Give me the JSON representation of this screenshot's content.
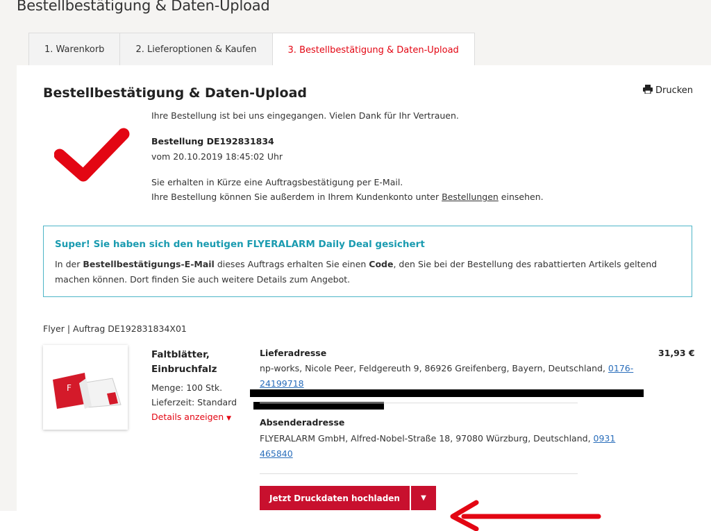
{
  "header": {
    "title": "Bestellbestätigung & Daten-Upload"
  },
  "tabs": [
    {
      "label": "1. Warenkorb"
    },
    {
      "label": "2. Lieferoptionen & Kaufen"
    },
    {
      "label": "3. Bestellbestätigung & Daten-Upload"
    }
  ],
  "confirmation": {
    "title": "Bestellbestätigung & Daten-Upload",
    "print_label": "Drucken",
    "thanks": "Ihre Bestellung ist bei uns eingegangen. Vielen Dank für Ihr Vertrauen.",
    "order_label": "Bestellung DE192831834",
    "order_date": "vom 20.10.2019 18:45:02 Uhr",
    "email_note": "Sie erhalten in Kürze eine Auftragsbestätigung per E-Mail.",
    "account_note_prefix": "Ihre Bestellung können Sie außerdem in Ihrem Kundenkonto unter",
    "account_link": "Bestellungen",
    "account_note_suffix": "einsehen."
  },
  "deal": {
    "title": "Super! Sie haben sich den heutigen FLYERALARM Daily Deal gesichert",
    "text_1": "In der",
    "text_bold_1": "Bestellbestätigungs-E-Mail",
    "text_2": "dieses Auftrags erhalten Sie einen",
    "text_bold_2": "Code",
    "text_3": ", den Sie bei der Bestellung des rabattierten Artikels geltend machen können. Dort finden Sie auch weitere Details zum Angebot."
  },
  "order": {
    "line": "Flyer | Auftrag DE192831834X01",
    "product_name": "Faltblätter, Einbruchfalz",
    "quantity": "Menge: 100 Stk.",
    "delivery": "Lieferzeit: Standard",
    "details_link": "Details anzeigen",
    "price": "31,93 €",
    "delivery_address_label": "Lieferadresse",
    "delivery_address": "np-works, Nicole Peer, Feldgereuth 9, 86926 Greifenberg, Bayern, Deutschland,",
    "delivery_phone": "0176-24199718",
    "sender_address_label": "Absenderadresse",
    "sender_address": "FLYERALARM GmbH, Alfred-Nobel-Straße 18, 97080 Würzburg, Deutschland,",
    "sender_phone": "0931 465840",
    "upload_button": "Jetzt Druckdaten hochladen"
  },
  "colors": {
    "brand_red": "#e30613",
    "button_red": "#c8102e",
    "deal_teal": "#1a9bb0",
    "link_blue": "#2a6ebb"
  },
  "icons": [
    "printer-icon",
    "checkmark-icon",
    "caret-down-icon",
    "arrow-left-icon",
    "product-thumbnail"
  ]
}
